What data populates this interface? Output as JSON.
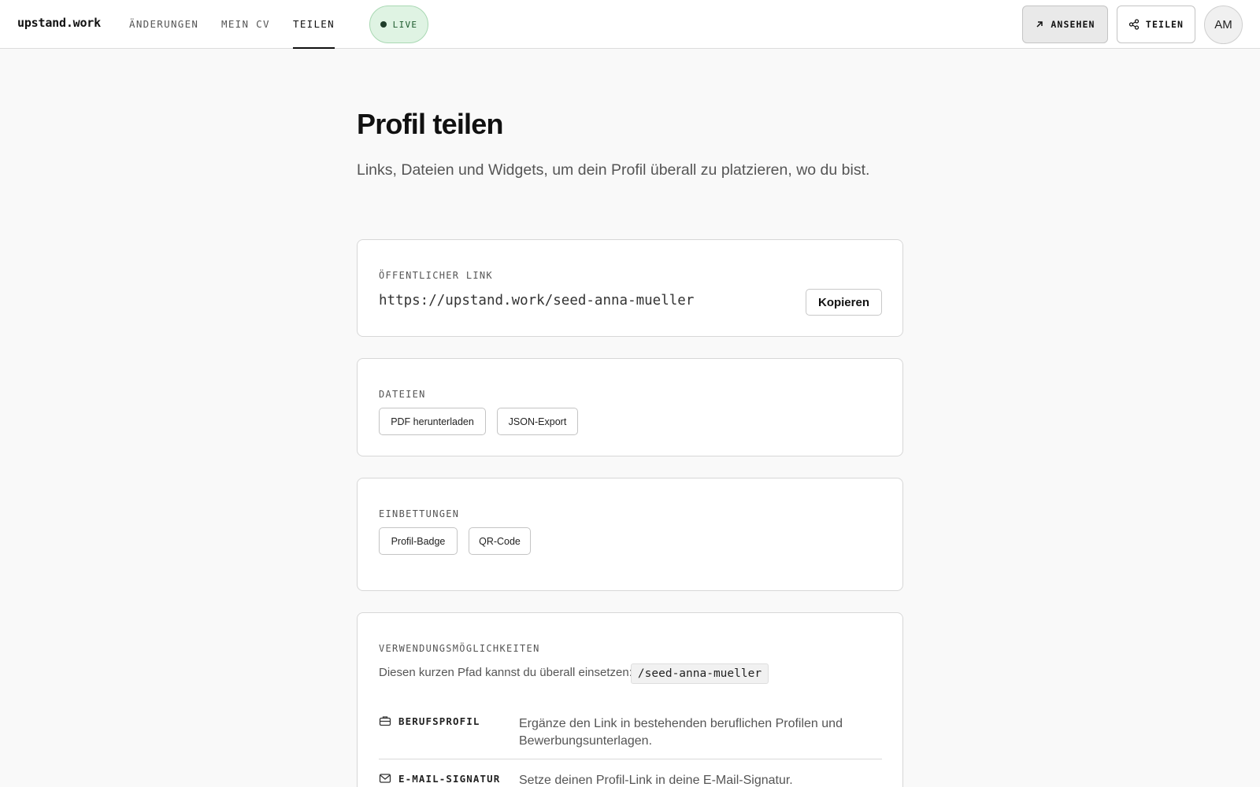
{
  "header": {
    "logo": "upstand.work",
    "nav": [
      {
        "label": "ÄNDERUNGEN"
      },
      {
        "label": "MEIN CV"
      },
      {
        "label": "TEILEN"
      }
    ],
    "status_label": "LIVE",
    "view_button": "ANSEHEN",
    "share_button": "TEILEN",
    "avatar_initials": "AM"
  },
  "main": {
    "title": "Profil teilen",
    "subtitle": "Links, Dateien und Widgets, um dein Profil überall zu platzieren, wo du bist.",
    "public_link": {
      "label": "ÖFFENTLICHER LINK",
      "url": "https://upstand.work/seed-anna-mueller",
      "copy_button": "Kopieren"
    },
    "files": {
      "label": "DATEIEN",
      "buttons": [
        "PDF herunterladen",
        "JSON-Export"
      ]
    },
    "embeds": {
      "label": "EINBETTUNGEN",
      "buttons": [
        "Profil-Badge",
        "QR-Code"
      ]
    },
    "usage": {
      "label": "VERWENDUNGSMÖGLICHKEITEN",
      "intro": "Diesen kurzen Pfad kannst du überall einsetzen:",
      "path": "/seed-anna-mueller",
      "rows": [
        {
          "icon": "briefcase-icon",
          "title": "BERUFSPROFIL",
          "description": "Ergänze den Link in bestehenden beruflichen Profilen und Bewerbungsunterlagen."
        },
        {
          "icon": "mail-icon",
          "title": "E-MAIL-SIGNATUR",
          "description": "Setze deinen Profil-Link in deine E-Mail-Signatur."
        }
      ]
    }
  },
  "colors": {
    "live_bg": "#dff3e3",
    "live_dot": "#1f3d2a",
    "page_bg": "#f9f9f9",
    "card_border": "#d7d7d7"
  }
}
